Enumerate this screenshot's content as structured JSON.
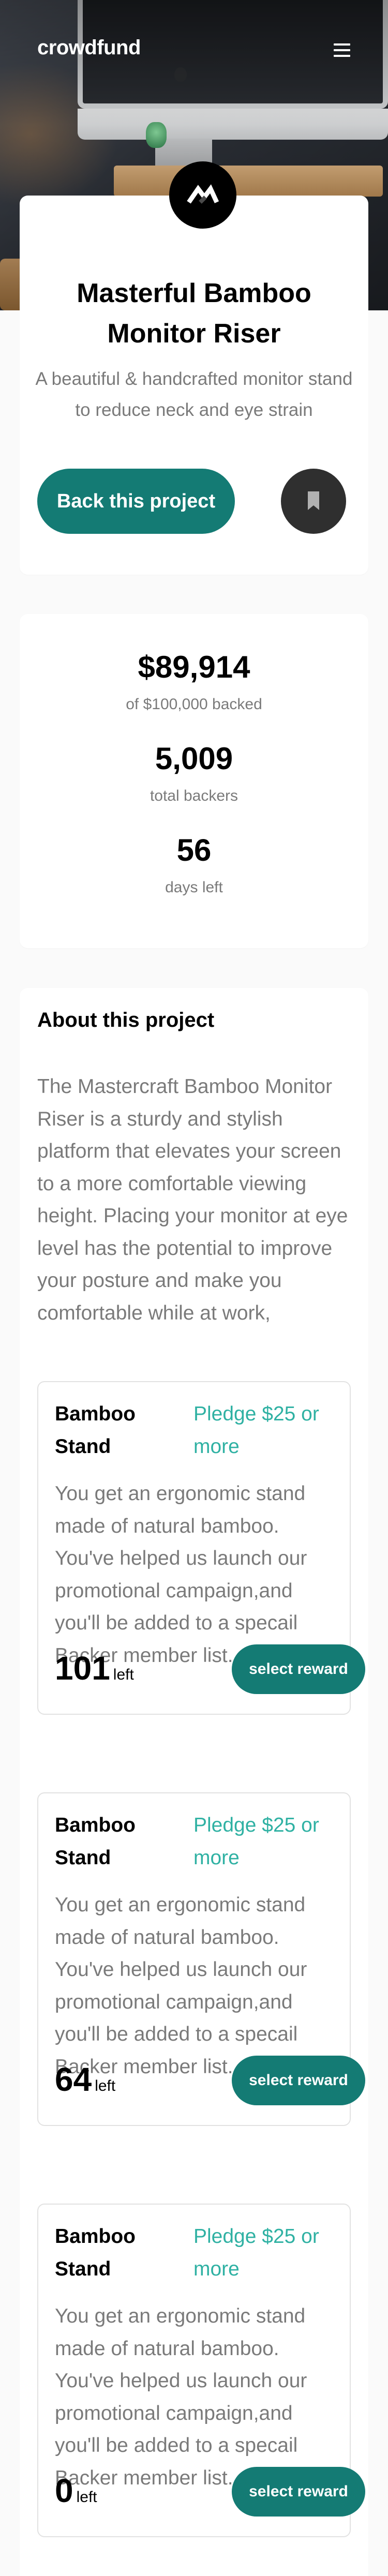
{
  "header": {
    "brand": "crowdfund",
    "menu_icon": "hamburger-menu-icon"
  },
  "project": {
    "title": "Masterful Bamboo Monitor Riser",
    "subtitle": "A beautiful & handcrafted monitor stand to reduce neck and eye strain",
    "back_button": "Back this project",
    "bookmark_icon": "bookmark-icon",
    "logo_icon": "mastercraft-logo-icon"
  },
  "stats": [
    {
      "value": "$89,914",
      "label": "of $100,000 backed"
    },
    {
      "value": "5,009",
      "label": "total backers"
    },
    {
      "value": "56",
      "label": "days left"
    }
  ],
  "about": {
    "title": "About this project",
    "text": "The Mastercraft Bamboo Monitor Riser is a sturdy and stylish platform that elevates your screen to a more comfortable viewing height. Placing your monitor at eye level has the potential to improve your posture and make you comfortable while at work,"
  },
  "rewards": [
    {
      "name": "Bamboo Stand",
      "pledge": "Pledge $25 or more",
      "description": "You get an ergonomic stand made of natural bamboo. You've helped us launch our promotional campaign,and you'll be added to a specail Backer member list.",
      "count": "101",
      "count_label": "left",
      "button": "select reward"
    },
    {
      "name": "Bamboo Stand",
      "pledge": "Pledge $25 or more",
      "description": "You get an ergonomic stand made of natural bamboo. You've helped us launch our promotional campaign,and you'll be added to a specail Backer member list.",
      "count": "64",
      "count_label": "left",
      "button": "select reward"
    },
    {
      "name": "Bamboo Stand",
      "pledge": "Pledge $25 or more",
      "description": "You get an ergonomic stand made of natural bamboo. You've helped us launch our promotional campaign,and you'll be added to a specail Backer member list.",
      "count": "0",
      "count_label": "left",
      "button": "select reward"
    }
  ],
  "colors": {
    "primary": "#147b74",
    "accent": "#2fb1a3",
    "dark": "#2f2f2f",
    "muted_text": "#7a7a7a"
  }
}
